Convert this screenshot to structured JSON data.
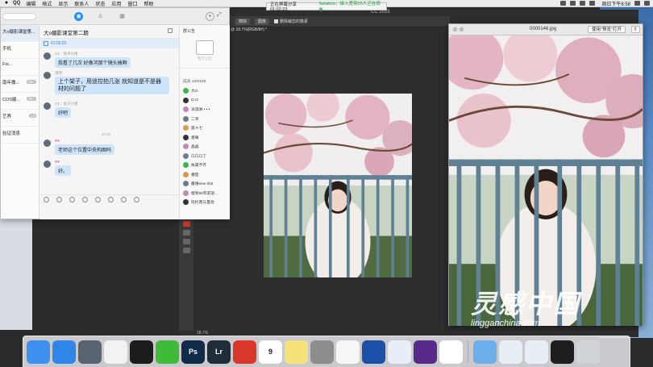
{
  "menubar": {
    "app_name": "QQ",
    "menus": [
      "编辑",
      "格式",
      "显示",
      "联系人",
      "状态",
      "应用",
      "窗口",
      "帮助"
    ],
    "clock": "周日下午8:58"
  },
  "share_banner": {
    "label": "正在屏幕分享 01:02:23",
    "network": "Salakins，接入宽带25人正在观看"
  },
  "photoshop": {
    "title": "CC 2015",
    "doc_tab": "@ 18.7%(RGB/8#) *",
    "toolbar": {
      "btn1": "擦除",
      "btn2": "图像",
      "checkbox": "删除裁剪的像素"
    },
    "zoom_status": "18.7%"
  },
  "preview": {
    "filename": "0000146.jpg",
    "open_button": "使用\"预览\"打开",
    "share_glyph": "⇧"
  },
  "watermark": {
    "cn": "灵感中国",
    "en": "lingganchina.com"
  },
  "qq": {
    "contacts": [
      {
        "name": "大o摄影课堂第...",
        "sub": "",
        "badge": ""
      },
      {
        "name": "手机",
        "sub": "",
        "badge": ""
      },
      {
        "name": "Foi...",
        "sub": "",
        "badge": ""
      },
      {
        "name": "南年撒...",
        "sub": "",
        "badge": "99+"
      },
      {
        "name": "COS摄...",
        "sub": "",
        "badge": "99+"
      },
      {
        "name": "艺界",
        "sub": "",
        "badge": "19"
      },
      {
        "name": "验证消息",
        "sub": "",
        "badge": ""
      }
    ],
    "chat": {
      "title": "大o摄影课堂第二期",
      "pinned_time": "01:02:23",
      "messages": [
        {
          "who": "O1：兔子小姐",
          "text": "我看了几次 好像河那个镜头搞啊"
        },
        {
          "who": "肃然",
          "text": "上个架子，用遥控拍几张 就知道是不是器材的问题了"
        },
        {
          "who": "O1：兔子小姐",
          "text": "好吧"
        },
        {
          "who": "",
          "hearts": "♥♥",
          "text": "老师这个位置中央构图吗"
        },
        {
          "who": "",
          "hearts": "♥♥",
          "text": "好。"
        }
      ],
      "divider_time": "20:55"
    },
    "side": {
      "header": "群公告",
      "notice_empty": "暂无公告",
      "member_count": "成员 100/158",
      "members": [
        "大O",
        "O.O",
        "冰淇淋 ▪ ▪ ▪",
        "二爷",
        "狐十七",
        "墨嘛",
        "晶晶",
        "ロロロ了",
        "执美不齐",
        "番茄",
        "最谁new shit",
        "傻到80年前退…",
        "玩托而与量亮"
      ]
    }
  },
  "dock": {
    "items": [
      {
        "name": "finder",
        "label": "",
        "color": "#3d8ff0"
      },
      {
        "name": "safari",
        "label": "",
        "color": "#2f86e8"
      },
      {
        "name": "launchpad",
        "label": "",
        "color": "#5a6372"
      },
      {
        "name": "reminders",
        "label": "",
        "color": "#f2f2f2"
      },
      {
        "name": "qq",
        "label": "",
        "color": "#1c1c1c"
      },
      {
        "name": "wechat",
        "label": "",
        "color": "#3fba3a"
      },
      {
        "name": "photoshop",
        "label": "Ps",
        "color": "#0f2a4a"
      },
      {
        "name": "lightroom",
        "label": "Lr",
        "color": "#1f2d3a"
      },
      {
        "name": "netease-music",
        "label": "",
        "color": "#d8372a"
      },
      {
        "name": "calendar",
        "label": "9",
        "color": "#ffffff"
      },
      {
        "name": "notes",
        "label": "",
        "color": "#f6e27a"
      },
      {
        "name": "system-preferences",
        "label": "",
        "color": "#8d8d8d"
      },
      {
        "name": "photos",
        "label": "",
        "color": "#f6f6f6"
      },
      {
        "name": "quicktime",
        "label": "",
        "color": "#1b4fa8"
      },
      {
        "name": "feishu",
        "label": "",
        "color": "#e8eef8"
      },
      {
        "name": "media-player",
        "label": "",
        "color": "#5a2a8a"
      },
      {
        "name": "baidu-netdisk",
        "label": "",
        "color": "#ffffff"
      },
      {
        "name": "downloads-folder",
        "label": "",
        "color": "#6aaeea"
      },
      {
        "name": "screenshot-1",
        "label": "",
        "color": "#e8eef6"
      },
      {
        "name": "screenshot-2",
        "label": "",
        "color": "#e8eef6"
      },
      {
        "name": "terminal-stack",
        "label": "",
        "color": "#1e1e1e"
      },
      {
        "name": "trash",
        "label": "",
        "color": "#d0d4d9"
      }
    ]
  }
}
